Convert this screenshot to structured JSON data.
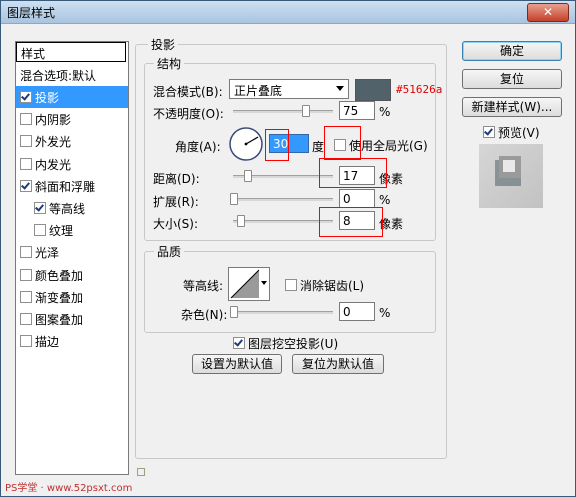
{
  "window": {
    "title": "图层样式",
    "close_label": "✕"
  },
  "sidebar": {
    "header": "样式",
    "blend_options": "混合选项:默认",
    "items": [
      {
        "label": "投影",
        "checked": true,
        "selected": true
      },
      {
        "label": "内阴影",
        "checked": false
      },
      {
        "label": "外发光",
        "checked": false
      },
      {
        "label": "内发光",
        "checked": false
      },
      {
        "label": "斜面和浮雕",
        "checked": true
      },
      {
        "label": "等高线",
        "checked": true,
        "indent": true
      },
      {
        "label": "纹理",
        "checked": false,
        "indent": true
      },
      {
        "label": "光泽",
        "checked": false
      },
      {
        "label": "颜色叠加",
        "checked": false
      },
      {
        "label": "渐变叠加",
        "checked": false
      },
      {
        "label": "图案叠加",
        "checked": false
      },
      {
        "label": "描边",
        "checked": false
      }
    ]
  },
  "shadow": {
    "section_title": "投影",
    "structure_title": "结构",
    "blend_mode_label": "混合模式(B):",
    "blend_mode_value": "正片叠底",
    "color_annotation": "#51626a",
    "color": "#51626a",
    "opacity_label": "不透明度(O):",
    "opacity_value": "75",
    "opacity_unit": "%",
    "angle_label": "角度(A):",
    "angle_value": "30",
    "angle_unit": "度",
    "global_light_label": "使用全局光(G)",
    "distance_label": "距离(D):",
    "distance_value": "17",
    "distance_unit": "像素",
    "spread_label": "扩展(R):",
    "spread_value": "0",
    "spread_unit": "%",
    "size_label": "大小(S):",
    "size_value": "8",
    "size_unit": "像素"
  },
  "quality": {
    "title": "品质",
    "contour_label": "等高线:",
    "antialias_label": "消除锯齿(L)",
    "noise_label": "杂色(N):",
    "noise_value": "0",
    "noise_unit": "%",
    "knockout_label": "图层挖空投影(U)",
    "set_default_label": "设置为默认值",
    "reset_default_label": "复位为默认值"
  },
  "buttons": {
    "ok": "确定",
    "reset": "复位",
    "new_style": "新建样式(W)...",
    "preview_label": "预览(V)"
  },
  "watermark": "PS学堂 · www.52psxt.com"
}
